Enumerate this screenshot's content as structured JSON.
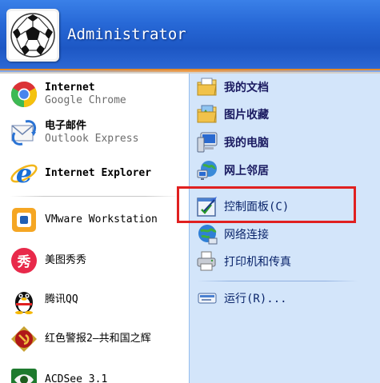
{
  "header": {
    "username": "Administrator"
  },
  "left_items": {
    "chrome": {
      "title": "Internet",
      "subtitle": "Google Chrome"
    },
    "outlook": {
      "title": "电子邮件",
      "subtitle": "Outlook Express"
    },
    "ie": {
      "title": "Internet Explorer"
    },
    "vmware": {
      "label": "VMware Workstation"
    },
    "meitu": {
      "label": "美图秀秀"
    },
    "qq": {
      "label": "腾讯QQ"
    },
    "redalert": {
      "label": "红色警报2—共和国之辉"
    },
    "acdsee": {
      "label": "ACDSee 3.1"
    }
  },
  "right_items": {
    "my_documents": "我的文档",
    "my_pictures": "图片收藏",
    "my_computer": "我的电脑",
    "network_places": "网上邻居",
    "control_panel": "控制面板(C)",
    "network_connections": "网络连接",
    "printers": "打印机和传真",
    "run": "运行(R)..."
  },
  "colors": {
    "header_blue": "#2768d6",
    "right_pane": "#d3e5fa",
    "highlight": "#e02020"
  },
  "icons": {
    "avatar": "soccer-ball-avatar",
    "chrome": "chrome-icon",
    "outlook": "outlook-express-icon",
    "ie": "internet-explorer-icon",
    "vmware": "vmware-icon",
    "meitu": "meitu-icon",
    "qq": "qq-penguin-icon",
    "redalert": "red-alert-icon",
    "acdsee": "acdsee-icon"
  }
}
